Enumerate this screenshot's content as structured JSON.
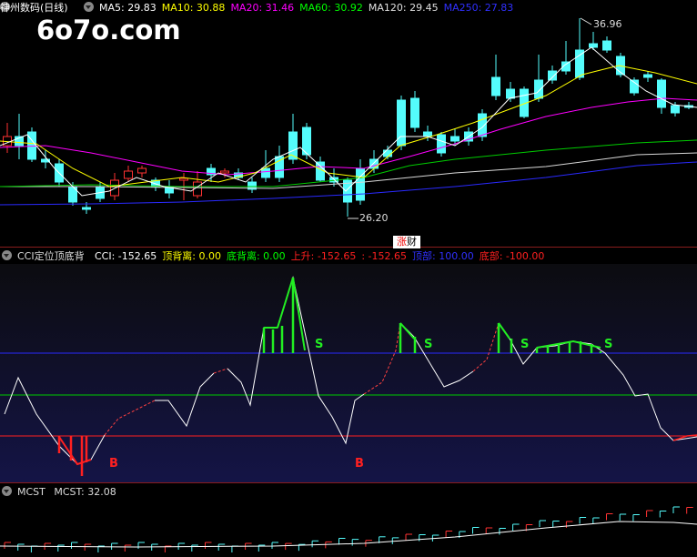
{
  "main": {
    "stock_name": "神州数码(日线)",
    "ma": [
      {
        "label": "MA5: 29.83",
        "color": "#ffffff"
      },
      {
        "label": "MA10: 30.88",
        "color": "#ffff00"
      },
      {
        "label": "MA20: 31.46",
        "color": "#ff00ff"
      },
      {
        "label": "MA60: 30.92",
        "color": "#00ff00"
      },
      {
        "label": "MA120: 29.45",
        "color": "#e0e0e0"
      },
      {
        "label": "MA250: 27.83",
        "color": "#3030ff"
      }
    ],
    "watermark": "6o7o.com",
    "high_label": "36.96",
    "low_label": "26.20",
    "badge": {
      "left": "涨",
      "right": "财"
    }
  },
  "cci": {
    "name": "CCI定位顶底背",
    "items": [
      {
        "label": "CCI: -152.65",
        "color": "#ffffff"
      },
      {
        "label": "顶背离: 0.00",
        "color": "#ffff00"
      },
      {
        "label": "底背离: 0.00",
        "color": "#00ff00"
      },
      {
        "label": "上升: -152.65",
        "color": "#ff2020"
      },
      {
        "label": ": -152.65",
        "color": "#ff2020"
      },
      {
        "label": "顶部: 100.00",
        "color": "#3030ff"
      },
      {
        "label": "底部: -100.00",
        "color": "#ff2020"
      }
    ],
    "signals": {
      "sell": "S",
      "buy": "B"
    }
  },
  "mcst": {
    "name": "MCST",
    "value_label": "MCST: 32.08"
  },
  "colors": {
    "up": "#ff3232",
    "down": "#54fcfc",
    "bg": "#000000"
  }
}
